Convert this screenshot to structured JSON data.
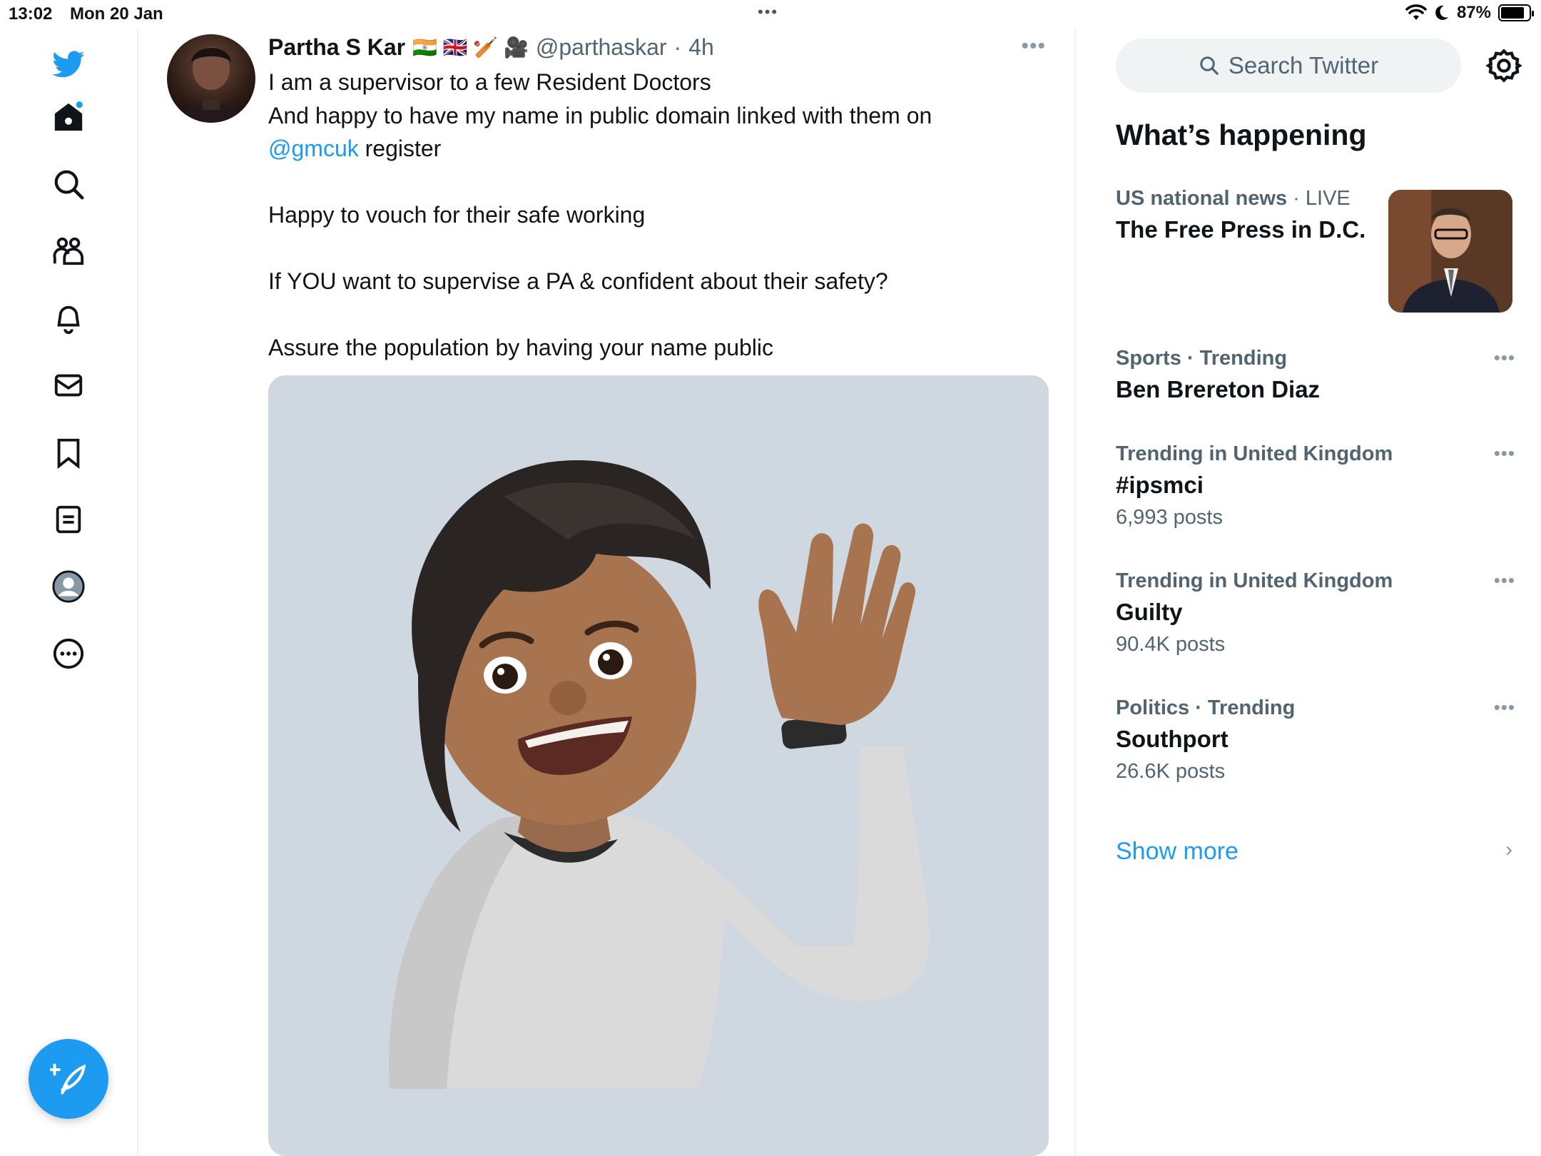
{
  "status_bar": {
    "time": "13:02",
    "date": "Mon 20 Jan",
    "battery_percent": "87%",
    "multitask_dots": "•••"
  },
  "left_nav": {
    "items": [
      {
        "name": "twitter-logo-icon"
      },
      {
        "name": "home-icon"
      },
      {
        "name": "explore-icon"
      },
      {
        "name": "communities-icon"
      },
      {
        "name": "notifications-icon"
      },
      {
        "name": "messages-icon"
      },
      {
        "name": "bookmarks-icon"
      },
      {
        "name": "lists-icon"
      },
      {
        "name": "profile-icon"
      },
      {
        "name": "more-icon"
      }
    ],
    "compose_icon": "compose-icon",
    "accent_color": "#1d9bf0"
  },
  "tweet": {
    "author": "Partha S Kar",
    "flair": "🇮🇳 🇬🇧 🏏 🎥",
    "handle": "@parthaskar",
    "separator": "·",
    "time_ago": "4h",
    "more": "•••",
    "line1": "I am a supervisor to a few Resident Doctors",
    "line2": "And happy to have my name in public domain linked with them on",
    "mention": "@gmcuk",
    "line3_rest": " register",
    "line4": "Happy to vouch for their safe working",
    "line5": "If YOU want to supervise a PA & confident about their safety?",
    "line6": "Assure the population by having your name public",
    "media_description_icon": "memoji-waving-image"
  },
  "sidebar": {
    "search_placeholder": "Search Twitter",
    "section_title": "What’s happening",
    "news": {
      "category": "US national news",
      "separator": "·",
      "status": "LIVE",
      "headline": "The Free Press in D.C."
    },
    "trends": [
      {
        "category": "Sports · Trending",
        "name": "Ben Brereton Diaz",
        "posts": ""
      },
      {
        "category": "Trending in United Kingdom",
        "name": "#ipsmci",
        "posts": "6,993 posts"
      },
      {
        "category": "Trending in United Kingdom",
        "name": "Guilty",
        "posts": "90.4K posts"
      },
      {
        "category": "Politics · Trending",
        "name": "Southport",
        "posts": "26.6K posts"
      }
    ],
    "more_label": "•••",
    "show_more": "Show more"
  }
}
